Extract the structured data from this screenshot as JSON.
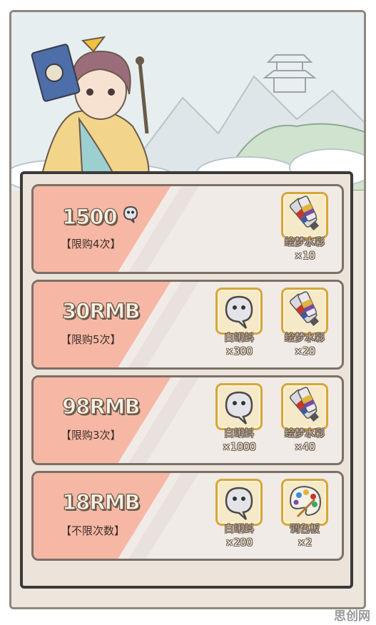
{
  "offers": [
    {
      "price": "1500",
      "price_icon": "ghost-currency-icon",
      "limit": "【限购4次】",
      "rewards": [
        {
          "icon": "paint-tubes-icon",
          "name": "绘梦水彩",
          "qty": "×10"
        }
      ]
    },
    {
      "price": "30RMB",
      "limit": "【限购5次】",
      "rewards": [
        {
          "icon": "ghost-currency-icon",
          "name": "白蝌蚪",
          "qty": "×300"
        },
        {
          "icon": "paint-tubes-icon",
          "name": "绘梦水彩",
          "qty": "×20"
        }
      ]
    },
    {
      "price": "98RMB",
      "limit": "【限购3次】",
      "rewards": [
        {
          "icon": "ghost-currency-icon",
          "name": "白蝌蚪",
          "qty": "×1000"
        },
        {
          "icon": "paint-tubes-icon",
          "name": "绘梦水彩",
          "qty": "×40"
        }
      ]
    },
    {
      "price": "18RMB",
      "limit": "【不限次数】",
      "rewards": [
        {
          "icon": "ghost-currency-icon",
          "name": "白蝌蚪",
          "qty": "×200"
        },
        {
          "icon": "palette-icon",
          "name": "调色板",
          "qty": "×2"
        }
      ]
    }
  ],
  "watermark": "思创网",
  "colors": {
    "accent_stripe": "#f6b8a4",
    "item_border": "#d6a63a",
    "card_border": "#7b7068"
  }
}
